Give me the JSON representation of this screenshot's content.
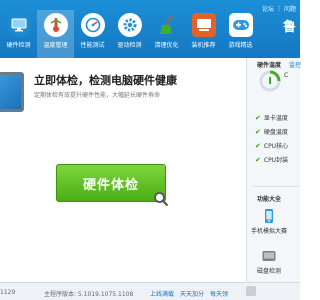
{
  "titlebar": {
    "links": [
      "论坛",
      "问题"
    ]
  },
  "brand": {
    "text": "鲁"
  },
  "nav": [
    {
      "label": "硬件检测",
      "icon": "monitor-icon",
      "color": "#2aa1e8"
    },
    {
      "label": "温度管理",
      "icon": "thermometer-icon",
      "color": "#ffffff"
    },
    {
      "label": "性能测试",
      "icon": "speedometer-icon",
      "color": "#28a0e6"
    },
    {
      "label": "驱动检测",
      "icon": "gear-icon",
      "color": "#2b9ee4"
    },
    {
      "label": "清理优化",
      "icon": "broom-icon",
      "color": "#4ca333"
    },
    {
      "label": "装机推荐",
      "icon": "computer-icon",
      "color": "#e6692c"
    },
    {
      "label": "游戏精选",
      "icon": "gamepad-icon",
      "color": "#2f98df"
    }
  ],
  "main": {
    "headline": "立即体检，检测电脑硬件健康",
    "subline": "定期体检有效提升硬件性能，大幅延长硬件寿命",
    "check_button": "硬件体检"
  },
  "panel": {
    "temp_title": "硬件温度",
    "temp_link": "监控",
    "temp_letter": "C",
    "temp_items": [
      "显卡温度",
      "硬盘温度",
      "CPU核心",
      "CPU封装"
    ],
    "tools_title": "功能大全",
    "tools": [
      {
        "label": "手机模拟大赛",
        "icon": "phone-icon"
      },
      {
        "label": "磁盘检测",
        "icon": "disk-icon"
      }
    ]
  },
  "status": {
    "version": "1129",
    "db": "主程序版本: 5.1019.1075.1108",
    "links": [
      "上线满载",
      "天天加分",
      "每天领"
    ]
  }
}
